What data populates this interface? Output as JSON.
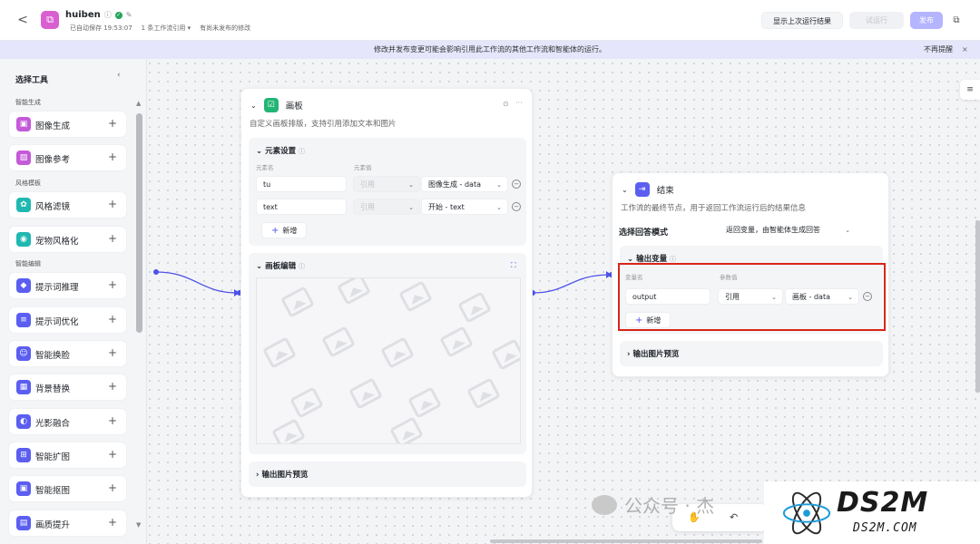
{
  "header": {
    "back": "<",
    "app_name": "huiben",
    "autosave": "已自动保存 19:53:07",
    "workflow_refs": "1 条工作流引用 ▾",
    "unpublished": "有尚未发布的修改",
    "btn_last_run": "显示上次运行结果",
    "btn_trial": "试运行",
    "btn_publish": "发布"
  },
  "notice": {
    "text": "修改并发布变更可能会影响引用此工作流的其他工作流和智能体的运行。",
    "dismiss": "不再提醒",
    "close": "×"
  },
  "sidebar": {
    "title": "选择工具",
    "groups": [
      {
        "label": "智能生成",
        "items": [
          {
            "label": "图像生成",
            "color": "#c45ad8",
            "icon": "▣"
          },
          {
            "label": "图像参考",
            "color": "#c45ad8",
            "icon": "▨"
          }
        ]
      },
      {
        "label": "风格模板",
        "items": [
          {
            "label": "风格滤镜",
            "color": "#1fb8b0",
            "icon": "✿"
          },
          {
            "label": "宠物风格化",
            "color": "#1fb8b0",
            "icon": "◉"
          }
        ]
      },
      {
        "label": "智能编辑",
        "items": [
          {
            "label": "提示词推理",
            "color": "#5b5ef0",
            "icon": "◆"
          },
          {
            "label": "提示词优化",
            "color": "#5b5ef0",
            "icon": "≡"
          },
          {
            "label": "智能换脸",
            "color": "#5b5ef0",
            "icon": "☺"
          },
          {
            "label": "背景替换",
            "color": "#5b5ef0",
            "icon": "▦"
          },
          {
            "label": "光影融合",
            "color": "#5b5ef0",
            "icon": "◐"
          },
          {
            "label": "智能扩图",
            "color": "#5b5ef0",
            "icon": "⊞"
          },
          {
            "label": "智能抠图",
            "color": "#5b5ef0",
            "icon": "▣"
          },
          {
            "label": "画质提升",
            "color": "#5b5ef0",
            "icon": "▤"
          }
        ]
      }
    ]
  },
  "board_node": {
    "title": "画板",
    "desc": "自定义画板排版，支持引用添加文本和图片",
    "elements_title": "元素设置",
    "col_name": "元素名",
    "col_value": "元素值",
    "rows": [
      {
        "name": "tu",
        "type": "引用",
        "ref": "图像生成 - data"
      },
      {
        "name": "text",
        "type": "引用",
        "ref": "开始 - text"
      }
    ],
    "add": "新增",
    "edit_title": "画板编辑",
    "preview_title": "输出图片预览"
  },
  "end_node": {
    "title": "结束",
    "desc": "工作流的最终节点，用于返回工作流运行后的结果信息",
    "mode_label": "选择回答模式",
    "mode_value": "返回变量，由智能体生成回答",
    "output_title": "输出变量",
    "col_name": "变量名",
    "col_value": "参数值",
    "row": {
      "name": "output",
      "type": "引用",
      "ref": "画板 - data"
    },
    "add": "新增",
    "preview_title": "输出图片预览"
  },
  "watermark": {
    "wechat": "公众号 · 杰",
    "brand": "DS2M",
    "brand_url": "DS2M.COM"
  },
  "colors": {
    "accent": "#4d53e8",
    "highlight": "#d9241b"
  }
}
